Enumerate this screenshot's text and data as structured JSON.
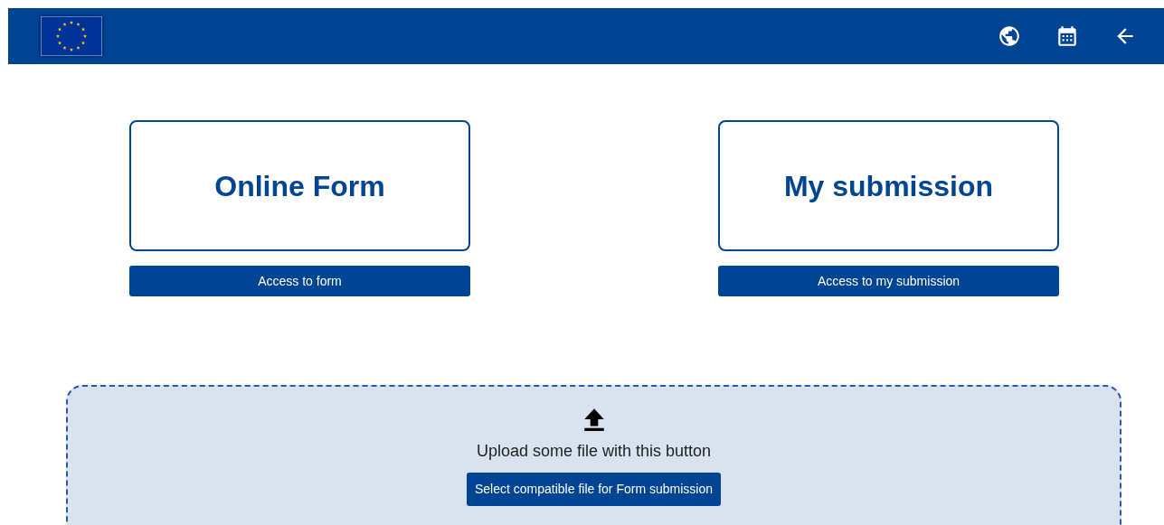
{
  "cards": [
    {
      "title": "Online Form",
      "button": "Access to form"
    },
    {
      "title": "My submission",
      "button": "Access to my submission"
    }
  ],
  "upload": {
    "text": "Upload some file with this button",
    "button": "Select compatible file for Form submission"
  }
}
